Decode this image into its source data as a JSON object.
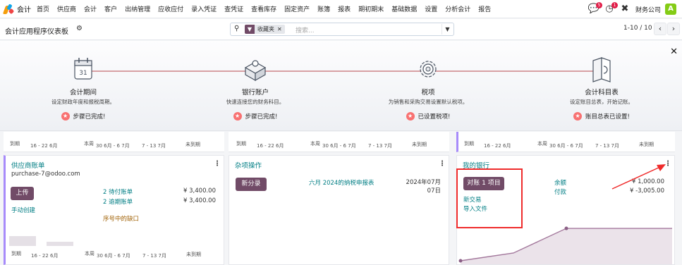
{
  "topnav": {
    "app_name": "会计",
    "menu": [
      "首页",
      "供应商",
      "会计",
      "客户",
      "出纳管理",
      "应收应付",
      "录入凭证",
      "查凭证",
      "查看库存",
      "固定资产",
      "账簿",
      "报表",
      "期初期末",
      "基础数据",
      "设置",
      "分析会计",
      "报告"
    ],
    "chat_count": "5",
    "activity_count": "1",
    "company": "财务公司",
    "avatar_letter": "A"
  },
  "control": {
    "page_title": "会计应用程序仪表板",
    "facet_label": "收藏夹",
    "search_placeholder": "搜索...",
    "pager": "1-10 / 10"
  },
  "onboarding": {
    "steps": [
      {
        "title": "会计期间",
        "desc": "设定财政年度和报税周期。",
        "status": "步骤已完成!"
      },
      {
        "title": "银行账户",
        "desc": "快速连接您的财务科目。",
        "status": "步骤已完成!"
      },
      {
        "title": "税项",
        "desc": "为销售和采购交易设置默认税项。",
        "status": "已设置税项!"
      },
      {
        "title": "会计科目表",
        "desc": "设定账目总表，开始记账。",
        "status": "账目总表已设置!"
      }
    ]
  },
  "graph_axis": {
    "labels": [
      "到期",
      "16 - 22 6月",
      "本周",
      "30 6月 - 6 7月",
      "7 - 13 7月",
      "未到期"
    ]
  },
  "vendor_card": {
    "title": "供应商账单",
    "email": "purchase-7@odoo.com",
    "upload": "上传",
    "manual": "手动创建",
    "waiting": "2 待付账单",
    "waiting_amount": "¥ 3,400.00",
    "overdue": "2 逾期账单",
    "overdue_amount": "¥ 3,400.00",
    "gap": "序号中的缺口"
  },
  "misc_card": {
    "title": "杂项操作",
    "new_entry": "新分录",
    "tax_report": "六月 2024的纳税申报表",
    "tax_date": "2024年07月07日"
  },
  "bank_card": {
    "title": "我的银行",
    "reconcile": "对账 1 项目",
    "new_tx": "新交易",
    "import_file": "导入文件",
    "balance_label": "余额",
    "balance": "¥ 1,000.00",
    "payments_label": "付款",
    "payments": "¥ -3,005.00"
  },
  "bank_graph": {
    "points": [
      1000,
      1000,
      3005,
      3005,
      3005,
      3005
    ]
  }
}
